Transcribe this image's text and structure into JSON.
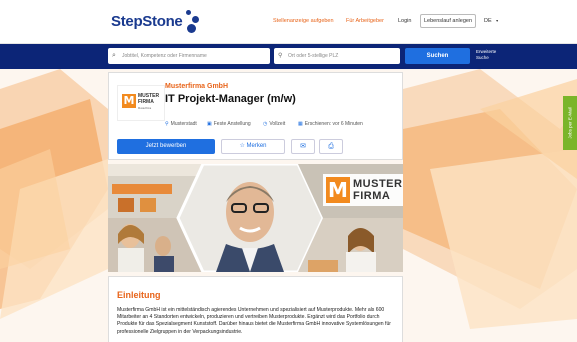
{
  "header": {
    "logo_text": "StepStone",
    "nav": {
      "post_job": "Stellenanzeige aufgeben",
      "for_employers": "Für Arbeitgeber",
      "login": "Login",
      "create_cv": "Lebenslauf anlegen",
      "language": "DE"
    }
  },
  "search": {
    "keyword_placeholder": "Jobtitel, Kompetenz oder Firmenname",
    "location_placeholder": "Ort oder 5-stellige PLZ",
    "submit_label": "Suchen",
    "advanced_label_1": "Erweiterte",
    "advanced_label_2": "Suche"
  },
  "job": {
    "company": "Musterfirma GmbH",
    "title": "IT Projekt-Manager (m/w)",
    "logo_line1": "MUSTER",
    "logo_line2": "FIRMA",
    "logo_letter": "M",
    "logo_sub": "Musterfirma",
    "meta": {
      "location": "Musterstadt",
      "employment": "Feste Anstellung",
      "hours": "Vollzeit",
      "published": "Erschienen: vor 6 Minuten"
    },
    "apply_label": "Jetzt bewerben",
    "save_label": "Merken"
  },
  "banner": {
    "logo_letter": "M",
    "logo_line1": "MUSTER",
    "logo_line2": "FIRMA"
  },
  "intro": {
    "title": "Einleitung",
    "text": "Musterfirma GmbH ist ein mittelständisch agierendes Unternehmen und spezialisiert auf Musterprodukte. Mehr als 600 Mitarbeiter an 4 Standorten entwickeln, produzieren und vertreiben Musterprodukte. Ergänzt wird das Portfolio durch Produkte für das Spezialsegment Kunststoff. Darüber hinaus bietet die Musterfirma GmbH innovative Systemlösungen für professionelle Zielgruppen in der Verpackungsindustrie."
  },
  "side_tab": {
    "label": "Jobs per E-Mail"
  },
  "colors": {
    "brand_blue": "#0c2577",
    "accent_orange": "#e8641a",
    "button_blue": "#1f6fe0",
    "side_green": "#7ab52a"
  }
}
